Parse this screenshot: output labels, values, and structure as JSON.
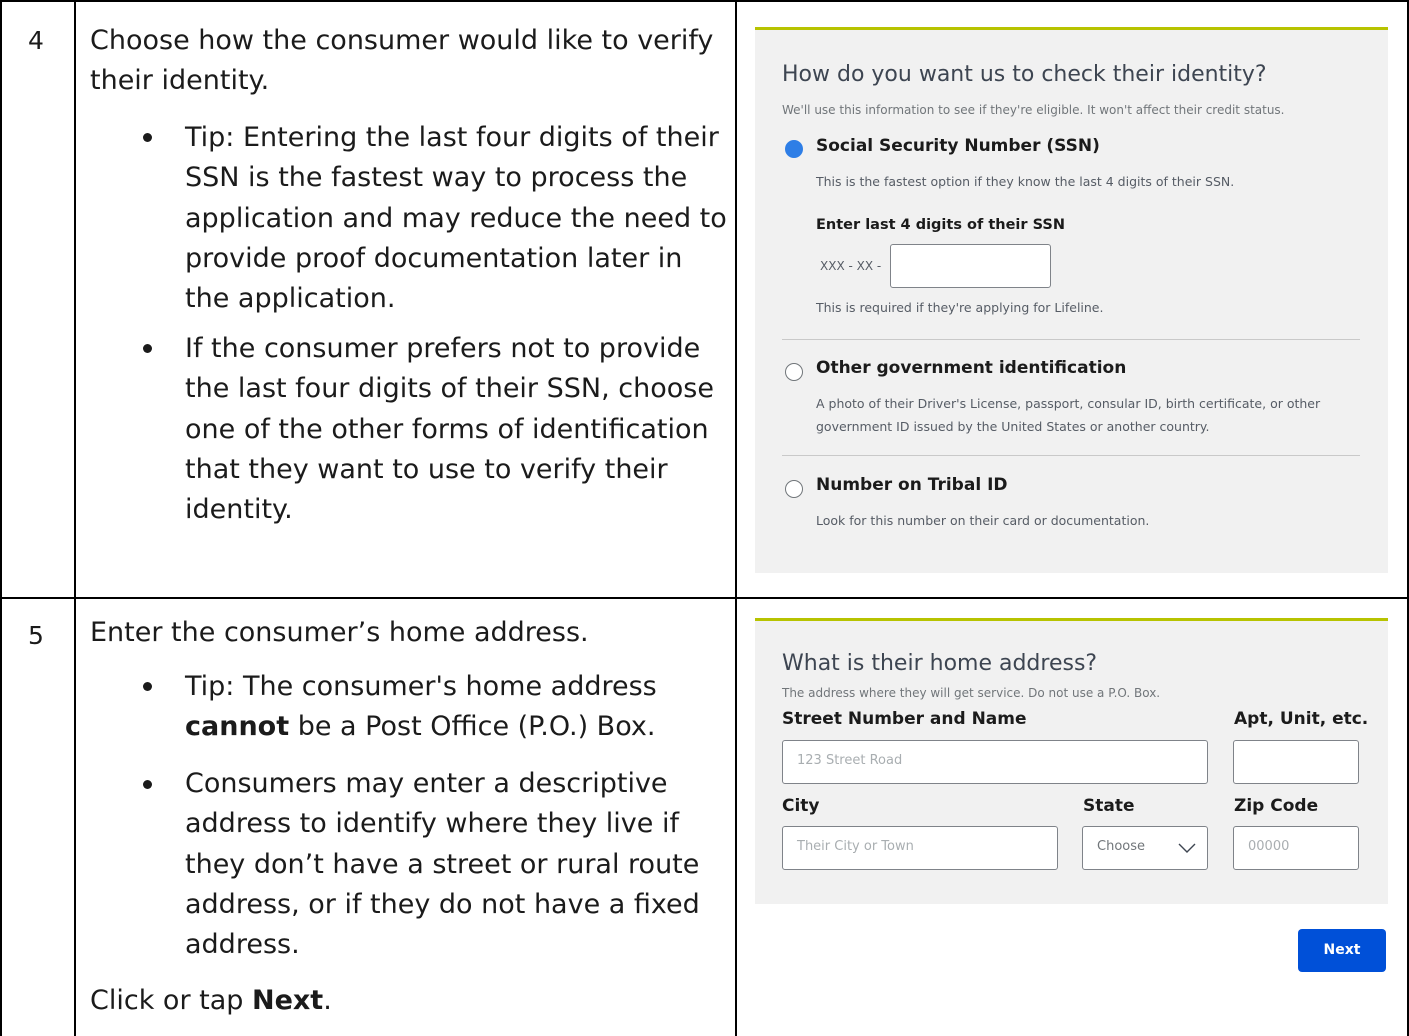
{
  "rows": [
    {
      "number": "4",
      "instruction": "Choose how the consumer would like to verify their identity.",
      "tips": [
        "Tip: Entering the last four digits of their SSN is the fastest way to process the application and may reduce the need to provide proof documentation later in the application.",
        "If the consumer prefers not to provide the last four digits of their SSN, choose one of the other forms of identification that they want to use to verify their identity."
      ]
    },
    {
      "number": "5",
      "instruction": "Enter the consumer’s home address.",
      "tip1_pre": "Tip: The consumer's home address ",
      "tip1_bold": "cannot",
      "tip1_post": " be a Post Office (P.O.) Box.",
      "tip2": "Consumers may enter a descriptive address to identify where they live if they don’t have a street or rural route address, or if they do not have a fixed address.",
      "click_pre": "Click or tap ",
      "click_bold": "Next",
      "click_post": "."
    }
  ],
  "identity_panel": {
    "title": "How do you want us to check their identity?",
    "subtitle": "We'll use this information to see if they're eligible. It won't affect their credit status.",
    "options": [
      {
        "label": "Social Security Number (SSN)",
        "description": "This is the fastest option if they know the last 4 digits of their SSN.",
        "selected": true
      },
      {
        "label": "Other government identification",
        "description": "A photo of their Driver's License, passport, consular ID, birth certificate, or other government ID issued by the United States or another country.",
        "selected": false
      },
      {
        "label": "Number on Tribal ID",
        "description": "Look for this number on their card or documentation.",
        "selected": false
      }
    ],
    "ssn": {
      "label": "Enter last 4 digits of their SSN",
      "prefix": "XXX - XX -",
      "value": "",
      "hint": "This is required if they're applying for Lifeline."
    }
  },
  "address_panel": {
    "title": "What is their home address?",
    "subtitle": "The address where they will get service. Do not use a P.O. Box.",
    "street": {
      "label": "Street Number and Name",
      "placeholder": "123 Street Road"
    },
    "apt": {
      "label": "Apt, Unit, etc.",
      "placeholder": ""
    },
    "city": {
      "label": "City",
      "placeholder": "Their City or Town"
    },
    "state": {
      "label": "State",
      "selected": "Choose"
    },
    "zip": {
      "label": "Zip Code",
      "placeholder": "00000"
    }
  },
  "next_button": {
    "label": "Next",
    "color": "#0050d8"
  },
  "accent_color": "#b7c300"
}
